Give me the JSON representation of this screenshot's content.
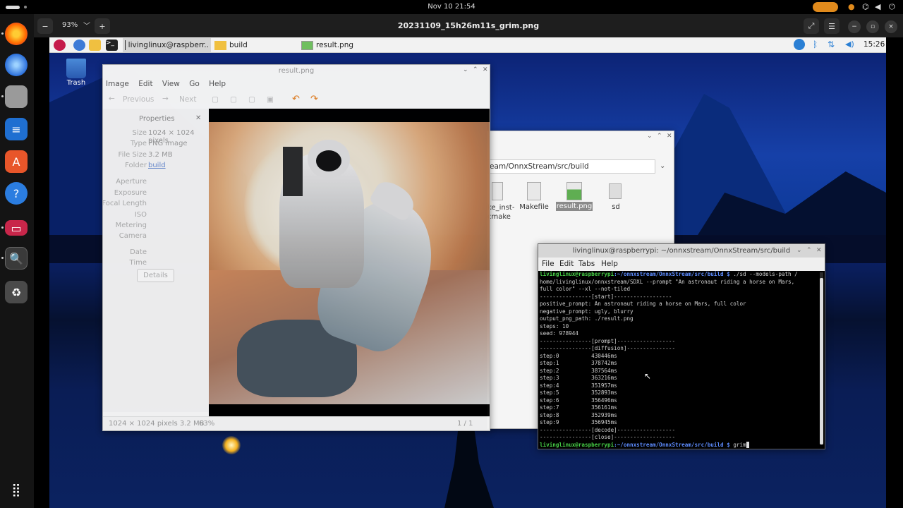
{
  "gnome": {
    "clock": "Nov 10  21:54"
  },
  "viewer": {
    "zoom": "93%",
    "title": "20231109_15h26m11s_grim.png"
  },
  "dock": {
    "items": [
      "firefox",
      "thunderbird",
      "files",
      "writer",
      "software",
      "help",
      "extension",
      "image-viewer",
      "trash"
    ],
    "grid_icon": "app-grid-icon"
  },
  "pi_panel": {
    "tasks": [
      {
        "label": "livinglinux@raspberr..",
        "icon": "terminal-icon"
      },
      {
        "label": "build",
        "icon": "folder-icon"
      },
      {
        "label": "result.png",
        "icon": "image-icon"
      }
    ],
    "time": "15:26"
  },
  "desktop": {
    "trash_label": "Trash"
  },
  "image_viewer": {
    "title": "result.png",
    "menu": [
      "Image",
      "Edit",
      "View",
      "Go",
      "Help"
    ],
    "nav": {
      "previous": "Previous",
      "next": "Next"
    },
    "properties": {
      "heading": "Properties",
      "rows": [
        {
          "key": "Size",
          "value": "1024 × 1024 pixels"
        },
        {
          "key": "Type",
          "value": "PNG image"
        },
        {
          "key": "File Size",
          "value": "3.2 MB"
        },
        {
          "key": "Folder",
          "value": "build"
        },
        {
          "key": "Aperture",
          "value": ""
        },
        {
          "key": "Exposure",
          "value": ""
        },
        {
          "key": "Focal Length",
          "value": ""
        },
        {
          "key": "ISO",
          "value": ""
        },
        {
          "key": "Metering",
          "value": ""
        },
        {
          "key": "Camera",
          "value": ""
        },
        {
          "key": "Date",
          "value": ""
        },
        {
          "key": "Time",
          "value": ""
        }
      ],
      "details_button": "Details"
    },
    "status": {
      "dims": "1024 × 1024 pixels  3.2 MB",
      "zoom": "63%",
      "page": "1 / 1"
    }
  },
  "file_manager": {
    "path": "eam/OnnxStream/src/build",
    "files": [
      {
        "label": "ke_inst-\ncmake",
        "selected": false
      },
      {
        "label": "Makefile",
        "selected": false
      },
      {
        "label": "result.png",
        "selected": true
      },
      {
        "label": "sd",
        "selected": false
      }
    ]
  },
  "terminal": {
    "title": "livinglinux@raspberrypi: ~/onnxstream/OnnxStream/src/build",
    "menu": [
      "File",
      "Edit",
      "Tabs",
      "Help"
    ],
    "prompt_user": "livinglinux@raspberrypi",
    "prompt_path": ":~/onnxstream/OnnxStream/src/build $",
    "command": " ./sd --models-path /",
    "lines": [
      "home/livinglinux/onnxstream/SDXL --prompt \"An astronaut riding a horse on Mars,",
      "full color\" --xl --not-tiled",
      "----------------[start]------------------",
      "positive_prompt: An astronaut riding a horse on Mars, full color",
      "negative_prompt: ugly, blurry",
      "output_png_path: ./result.png",
      "steps: 10",
      "seed: 978944",
      "----------------[prompt]------------------",
      "----------------[diffusion]---------------",
      "step:0          430446ms",
      "step:1          378742ms",
      "step:2          387564ms",
      "step:3          363216ms",
      "step:4          351957ms",
      "step:5          352893ms",
      "step:6          356496ms",
      "step:7          356161ms",
      "step:8          352939ms",
      "step:9          356945ms",
      "----------------[decode]------------------",
      "----------------[close]-------------------"
    ],
    "last_command": " grim"
  }
}
